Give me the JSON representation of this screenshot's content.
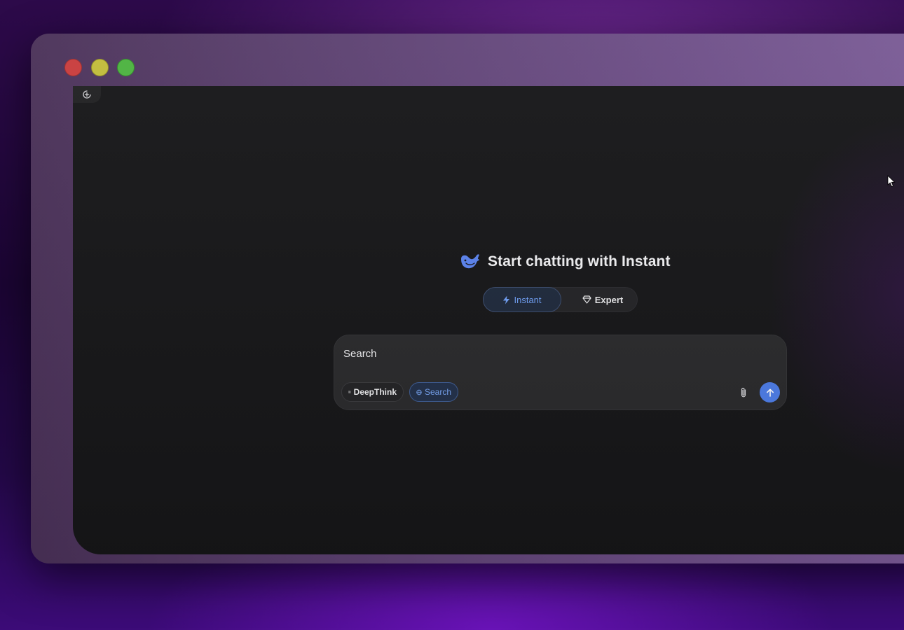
{
  "window": {
    "controls": [
      "close",
      "minimize",
      "maximize"
    ]
  },
  "main": {
    "heading": "Start chatting with Instant",
    "logo_icon": "whale-logo-icon",
    "modes": [
      {
        "label": "Instant",
        "icon": "lightning-icon",
        "selected": true
      },
      {
        "label": "Expert",
        "icon": "diamond-icon",
        "selected": false
      }
    ],
    "composer": {
      "input_value": "Search",
      "deepthink_label": "DeepThink",
      "search_label": "Search",
      "attach_icon": "paperclip-icon",
      "send_icon": "arrow-up-icon"
    }
  },
  "colors": {
    "accent": "#4d7de8",
    "accent_text": "#6f9ff5",
    "app_background": "#161618",
    "composer_background": "#2a2a2c"
  }
}
